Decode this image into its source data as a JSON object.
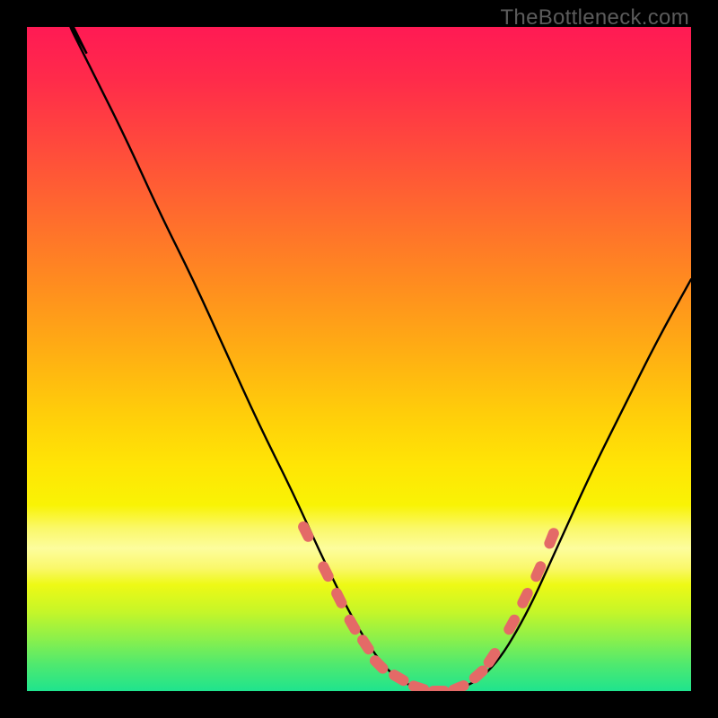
{
  "watermark": "TheBottleneck.com",
  "colors": {
    "page_bg": "#000000",
    "curve_stroke": "#000000",
    "marker_fill": "#e46a67",
    "gradient_top": "#ff1a54",
    "gradient_bottom": "#1fe48e"
  },
  "chart_data": {
    "type": "line",
    "title": "",
    "xlabel": "",
    "ylabel": "",
    "xlim": [
      0,
      100
    ],
    "ylim": [
      0,
      100
    ],
    "x": [
      0,
      5,
      10,
      15,
      20,
      25,
      30,
      35,
      40,
      45,
      50,
      55,
      60,
      65,
      70,
      75,
      80,
      85,
      90,
      95,
      100
    ],
    "series": [
      {
        "name": "bottleneck-curve",
        "values": [
          114,
          103,
          93,
          83,
          72,
          62,
          51,
          40,
          30,
          19,
          9,
          2,
          0,
          0,
          3,
          11,
          22,
          33,
          43,
          53,
          62
        ]
      }
    ],
    "markers": {
      "name": "highlight-band",
      "shape": "rounded-bar",
      "points": [
        {
          "x": 42,
          "y": 24
        },
        {
          "x": 45,
          "y": 18
        },
        {
          "x": 47,
          "y": 14
        },
        {
          "x": 49,
          "y": 10
        },
        {
          "x": 51,
          "y": 7
        },
        {
          "x": 53,
          "y": 4
        },
        {
          "x": 56,
          "y": 2
        },
        {
          "x": 59,
          "y": 0.5
        },
        {
          "x": 62,
          "y": 0
        },
        {
          "x": 65,
          "y": 0.5
        },
        {
          "x": 68,
          "y": 2.5
        },
        {
          "x": 70,
          "y": 5
        },
        {
          "x": 73,
          "y": 10
        },
        {
          "x": 75,
          "y": 14
        },
        {
          "x": 77,
          "y": 18
        },
        {
          "x": 79,
          "y": 23
        }
      ]
    }
  }
}
